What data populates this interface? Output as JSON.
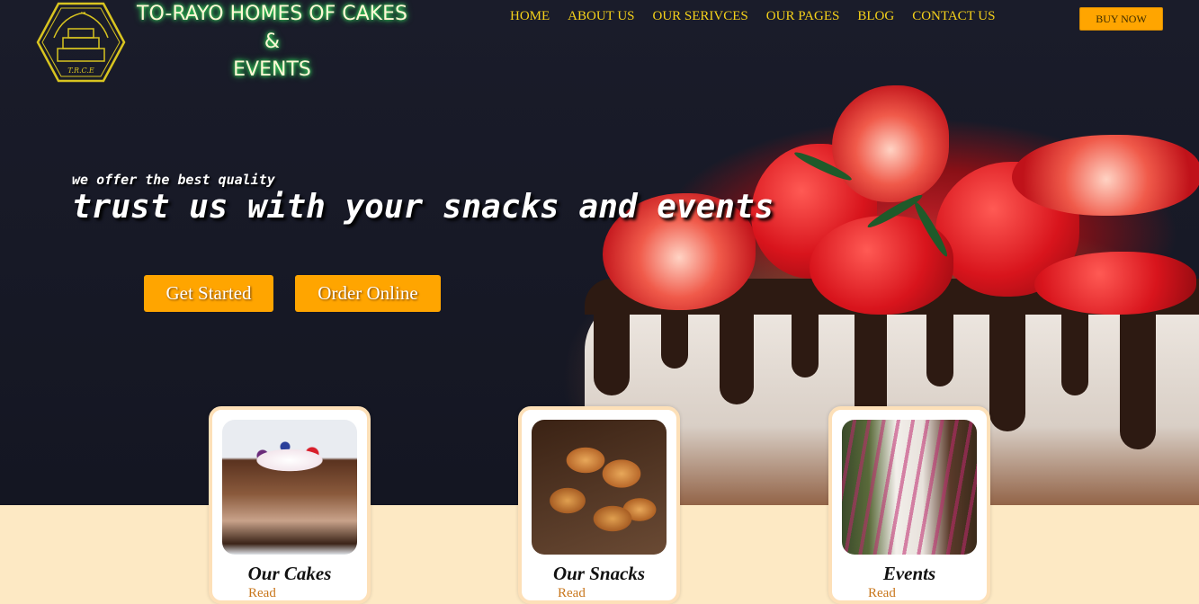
{
  "brand": {
    "line1": "TO-RAYO HOMES OF CAKES",
    "line2": "&",
    "line3": "EVENTS",
    "logo_text": "T.R.C.E"
  },
  "nav": {
    "items": [
      "HOME",
      "ABOUT US",
      "OUR SERIVCES",
      "OUR PAGES",
      "BLOG",
      "CONTACT US"
    ],
    "buy_label": "BUY NOW"
  },
  "hero": {
    "tagline": "we offer the best quality",
    "headline": "trust us with your snacks and events",
    "get_started": "Get Started",
    "order_online": "Order Online"
  },
  "cards": [
    {
      "title": "Our Cakes",
      "link": "Read"
    },
    {
      "title": "Our Snacks",
      "link": "Read"
    },
    {
      "title": "Events",
      "link": "Read"
    }
  ],
  "colors": {
    "accent": "#ffa500",
    "nav": "#f6d21a",
    "page_bg": "#fde9c4"
  }
}
